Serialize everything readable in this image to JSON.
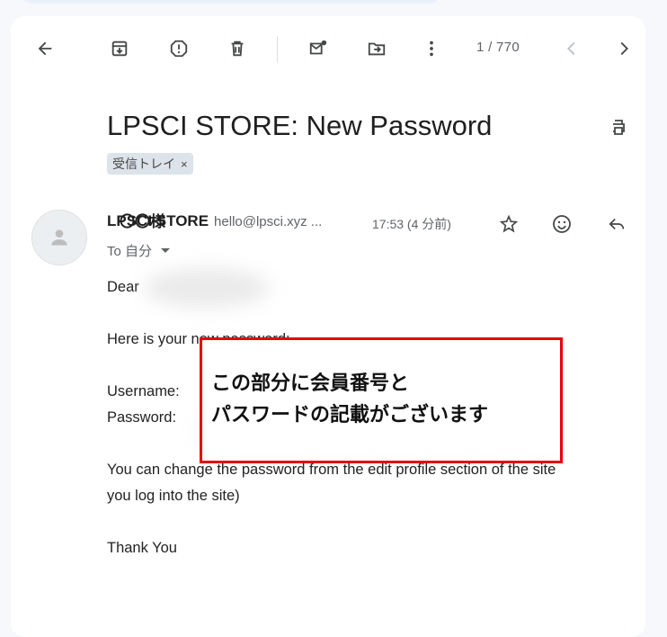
{
  "toolbar": {
    "back": "back-arrow-icon",
    "archive": "archive-icon",
    "report_spam": "report-spam-icon",
    "delete": "trash-icon",
    "mark_unread": "mark-unread-icon",
    "move_to": "move-to-icon",
    "more": "more-vert-icon",
    "page_count": "1 / 770",
    "prev": "chevron-left-icon",
    "next": "chevron-right-icon"
  },
  "message": {
    "subject": "LPSCI STORE: New Password",
    "label": "受信トレイ",
    "label_remove": "×",
    "sender_name": "LPSCI STORE",
    "sender_overlay": "〇〇様",
    "sender_email": "hello@lpsci.xyz ...",
    "time": "17:53 (4 分前)",
    "to": "To 自分",
    "greeting": "Dear",
    "intro": "Here is your new password:",
    "username_label": "Username:",
    "password_label": "Password:",
    "change_note": "You can change the password from the edit profile section of the site",
    "change_note_2": "you log into the site)",
    "closing": "Thank You"
  },
  "annotation": {
    "line1": "この部分に会員番号と",
    "line2": "パスワードの記載がございます"
  },
  "colors": {
    "accent_red": "#e6000f",
    "chip_bg": "#dde3ea",
    "page_bg": "#f6f8fc"
  }
}
